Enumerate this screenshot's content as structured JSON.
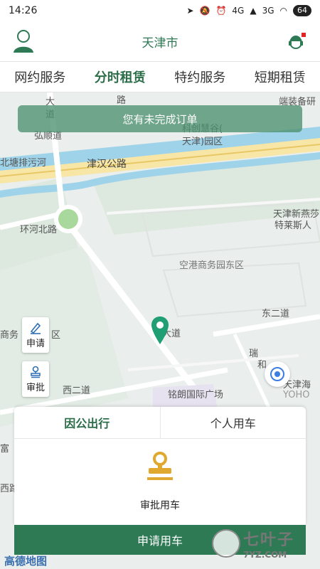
{
  "status_bar": {
    "time": "14:26",
    "signal": "4G",
    "signal2": "3G",
    "battery": "64"
  },
  "header": {
    "title": "天津市",
    "avatar_icon": "user-avatar-icon",
    "service_icon": "customer-service-icon"
  },
  "tabs": [
    {
      "label": "网约服务"
    },
    {
      "label": "分时租赁"
    },
    {
      "label": "特约服务"
    },
    {
      "label": "短期租赁"
    }
  ],
  "banner": {
    "text": "您有未完成订单"
  },
  "map_labels": {
    "l1": "大",
    "l2": "道",
    "l3": "路",
    "l4": "弘顺道",
    "l5": "北塘排污河",
    "l6": "津汉公路",
    "l7": "环河北路",
    "l8": "空港商务园东区",
    "l9": "天津新燕莎",
    "l10": "特莱斯人",
    "l11": "东二道",
    "l12": "西二道",
    "l13": "铭朗国际广场",
    "l14": "商务",
    "l15": "区",
    "l16": "科创慧谷(",
    "l17": "天津)园区",
    "l18": "端装备研",
    "l19": "瑞",
    "l20": "和",
    "l21": "大道",
    "l22": "天津海",
    "l23": "YOHO",
    "l24": "富",
    "l25": "西路"
  },
  "side_buttons": {
    "apply": "申请",
    "approve": "审批"
  },
  "card": {
    "tabs": [
      {
        "label": "因公出行"
      },
      {
        "label": "个人用车"
      }
    ],
    "approval_label": "审批用车"
  },
  "apply_button": "申请用车",
  "map_logo": "高德地图",
  "watermark": {
    "big": "七叶子",
    "small": "7YZ.COM"
  },
  "colors": {
    "brand_green": "#2e7a55",
    "banner_green": "#4b916e",
    "approval_gold": "#e0a82e"
  }
}
